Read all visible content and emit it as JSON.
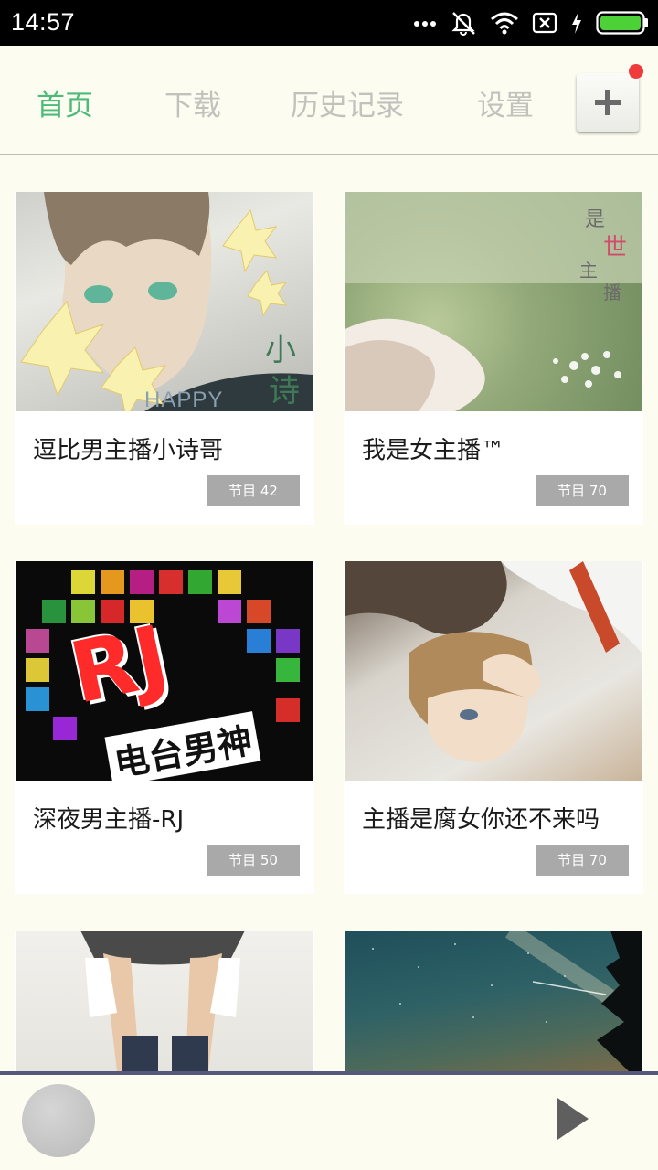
{
  "status_bar": {
    "time": "14:57",
    "icons": [
      "more-dots-icon",
      "mute-icon",
      "wifi-icon",
      "no-sim-icon",
      "charging-icon",
      "battery-icon"
    ],
    "battery_color": "#4cd136"
  },
  "header": {
    "tabs": [
      {
        "label": "首页",
        "active": true
      },
      {
        "label": "下载",
        "active": false
      },
      {
        "label": "历史记录",
        "active": false
      },
      {
        "label": "设置",
        "active": false
      }
    ],
    "add_icon": "plus-icon",
    "notification_dot_color": "#ef3b3b",
    "active_color": "#4dbb78"
  },
  "cards": [
    {
      "title": "逗比男主播小诗哥",
      "badge": "节目 42",
      "cover_text": [
        "小",
        "诗",
        "HAPPY"
      ]
    },
    {
      "title": "我是女主播™",
      "badge": "节目 70",
      "cover_text": [
        "是",
        "世",
        "主",
        "播"
      ]
    },
    {
      "title": "深夜男主播-RJ",
      "badge": "节目 50",
      "cover_text": [
        "RJ",
        "电台男神"
      ]
    },
    {
      "title": "主播是腐女你还不来吗",
      "badge": "节目 70",
      "cover_text": []
    },
    {
      "title": "",
      "badge": "",
      "cover_text": []
    },
    {
      "title": "",
      "badge": "",
      "cover_text": []
    }
  ],
  "player": {
    "avatar": "player-avatar",
    "play_icon": "play-icon"
  }
}
